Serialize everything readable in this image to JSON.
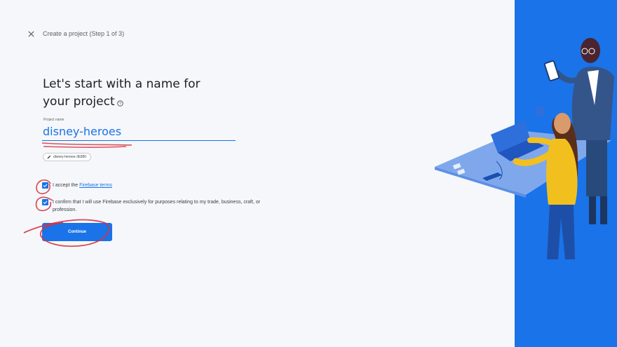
{
  "header": {
    "close_icon": "close-icon",
    "step_title": "Create a project (Step 1 of 3)"
  },
  "main": {
    "heading_line1": "Let's start with a name for",
    "heading_line2": "your project",
    "help_icon": "question-circle-icon",
    "project_name_label": "Project name",
    "project_name_value": "disney-heroes",
    "project_id_chip": "disney-heroes-3b380",
    "edit_icon": "pencil-icon"
  },
  "checkboxes": [
    {
      "checked": true,
      "text_before": "I accept the ",
      "link": "Firebase terms"
    },
    {
      "checked": true,
      "text": "I confirm that I will use Firebase exclusively for purposes relating to my trade, business, craft, or profession."
    }
  ],
  "continue_label": "Continue",
  "colors": {
    "accent": "#1a73e8",
    "background": "#f5f7fa",
    "annotation": "#d8323f"
  }
}
